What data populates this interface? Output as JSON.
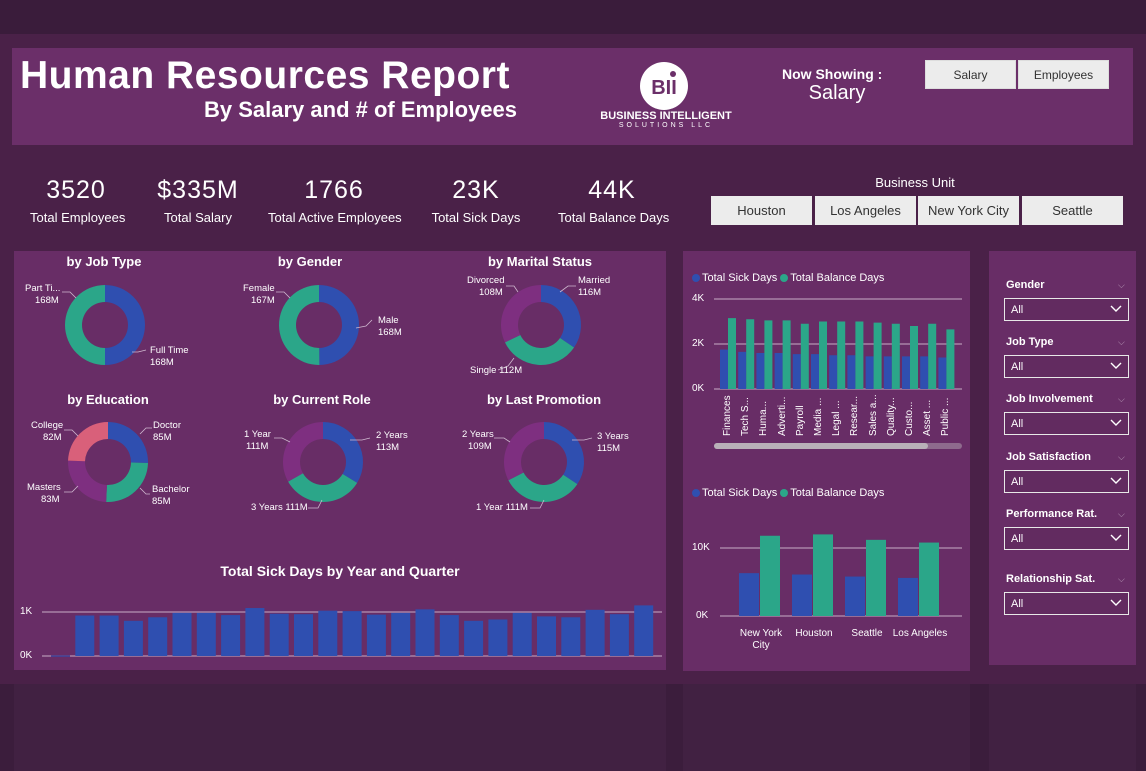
{
  "header": {
    "title": "Human Resources Report",
    "subtitle": "By Salary and # of Employees",
    "logo_line1": "BUSINESS INTELLIGENT",
    "logo_line2": "SOLUTIONS LLC",
    "logo_mark": "BII",
    "now_showing_label": "Now Showing :",
    "now_showing_value": "Salary",
    "btn_salary": "Salary",
    "btn_employees": "Employees"
  },
  "kpis": [
    {
      "value": "3520",
      "label": "Total Employees"
    },
    {
      "value": "$335M",
      "label": "Total Salary"
    },
    {
      "value": "1766",
      "label": "Total Active Employees"
    },
    {
      "value": "23K",
      "label": "Total Sick Days"
    },
    {
      "value": "44K",
      "label": "Total Balance Days"
    }
  ],
  "business_unit": {
    "title": "Business Unit",
    "options": [
      "Houston",
      "Los Angeles",
      "New York City",
      "Seattle"
    ]
  },
  "donuts": {
    "job_type": {
      "title": "by Job Type",
      "labels": [
        {
          "name": "Part Ti...",
          "value": "168M"
        },
        {
          "name": "Full Time",
          "value": "168M"
        }
      ]
    },
    "gender": {
      "title": "by Gender",
      "labels": [
        {
          "name": "Female",
          "value": "167M"
        },
        {
          "name": "Male",
          "value": "168M"
        }
      ]
    },
    "marital": {
      "title": "by Marital Status",
      "labels": [
        {
          "name": "Divorced",
          "value": "108M"
        },
        {
          "name": "Married",
          "value": "116M"
        },
        {
          "name": "Single",
          "value": "112M"
        }
      ]
    },
    "education": {
      "title": "by Education",
      "labels": [
        {
          "name": "College",
          "value": "82M"
        },
        {
          "name": "Doctor",
          "value": "85M"
        },
        {
          "name": "Masters",
          "value": "83M"
        },
        {
          "name": "Bachelor",
          "value": "85M"
        }
      ]
    },
    "current_role": {
      "title": "by Current Role",
      "labels": [
        {
          "name": "1 Year",
          "value": "111M"
        },
        {
          "name": "2 Years",
          "value": "113M"
        },
        {
          "name": "3 Years",
          "value": "111M"
        }
      ]
    },
    "last_promotion": {
      "title": "by Last Promotion",
      "labels": [
        {
          "name": "2 Years",
          "value": "109M"
        },
        {
          "name": "3 Years",
          "value": "115M"
        },
        {
          "name": "1 Year",
          "value": "111M"
        }
      ]
    }
  },
  "filters": [
    {
      "label": "Gender",
      "value": "All"
    },
    {
      "label": "Job Type",
      "value": "All"
    },
    {
      "label": "Job Involvement",
      "value": "All"
    },
    {
      "label": "Job Satisfaction",
      "value": "All"
    },
    {
      "label": "Performance Rat.",
      "value": "All"
    },
    {
      "label": "Relationship Sat.",
      "value": "All"
    }
  ],
  "colors": {
    "blue": "#2f4fb0",
    "teal": "#2ba689",
    "purple": "#7e2f80",
    "pink": "#d9607a",
    "panel": "#682d66"
  },
  "chart_data": [
    {
      "type": "pie",
      "title": "by Job Type",
      "categories": [
        "Part Ti...",
        "Full Time"
      ],
      "values": [
        168,
        168
      ]
    },
    {
      "type": "pie",
      "title": "by Gender",
      "categories": [
        "Female",
        "Male"
      ],
      "values": [
        167,
        168
      ]
    },
    {
      "type": "pie",
      "title": "by Marital Status",
      "categories": [
        "Married",
        "Single",
        "Divorced"
      ],
      "values": [
        116,
        112,
        108
      ]
    },
    {
      "type": "pie",
      "title": "by Education",
      "categories": [
        "Doctor",
        "Bachelor",
        "Masters",
        "College"
      ],
      "values": [
        85,
        85,
        83,
        82
      ]
    },
    {
      "type": "pie",
      "title": "by Current Role",
      "categories": [
        "2 Years",
        "3 Years",
        "1 Year"
      ],
      "values": [
        113,
        111,
        111
      ]
    },
    {
      "type": "pie",
      "title": "by Last Promotion",
      "categories": [
        "3 Years",
        "1 Year",
        "2 Years"
      ],
      "values": [
        115,
        111,
        109
      ]
    },
    {
      "type": "bar",
      "title": "Total Sick Days by Year and Quarter",
      "yticks": [
        "0K",
        "1K"
      ],
      "ylim": [
        0,
        1000
      ],
      "values": [
        10,
        920,
        920,
        800,
        880,
        980,
        980,
        930,
        1090,
        960,
        950,
        1030,
        1020,
        940,
        980,
        1060,
        930,
        800,
        830,
        980,
        900,
        880,
        1050,
        950,
        1150
      ]
    },
    {
      "type": "bar",
      "title": "",
      "legend": [
        "Total Sick Days",
        "Total Balance Days"
      ],
      "yticks": [
        "0K",
        "2K",
        "4K"
      ],
      "ylim": [
        0,
        4000
      ],
      "categories": [
        "Finances",
        "Tech S...",
        "Huma...",
        "Adverti...",
        "Payroll",
        "Media ...",
        "Legal ...",
        "Resear...",
        "Sales a...",
        "Quality...",
        "Custo...",
        "Asset ...",
        "Public ..."
      ],
      "series": [
        {
          "name": "Total Sick Days",
          "values": [
            1750,
            1650,
            1600,
            1600,
            1550,
            1550,
            1500,
            1500,
            1450,
            1450,
            1450,
            1450,
            1400
          ]
        },
        {
          "name": "Total Balance Days",
          "values": [
            3150,
            3100,
            3050,
            3050,
            2900,
            3000,
            3000,
            3000,
            2950,
            2900,
            2800,
            2900,
            2650
          ]
        }
      ]
    },
    {
      "type": "bar",
      "title": "",
      "legend": [
        "Total Sick Days",
        "Total Balance Days"
      ],
      "yticks": [
        "0K",
        "10K"
      ],
      "ylim": [
        0,
        10000
      ],
      "categories": [
        "New York City",
        "Houston",
        "Seattle",
        "Los Angeles"
      ],
      "series": [
        {
          "name": "Total Sick Days",
          "values": [
            6300,
            6100,
            5800,
            5600
          ]
        },
        {
          "name": "Total Balance Days",
          "values": [
            11800,
            12000,
            11200,
            10800
          ]
        }
      ]
    }
  ]
}
